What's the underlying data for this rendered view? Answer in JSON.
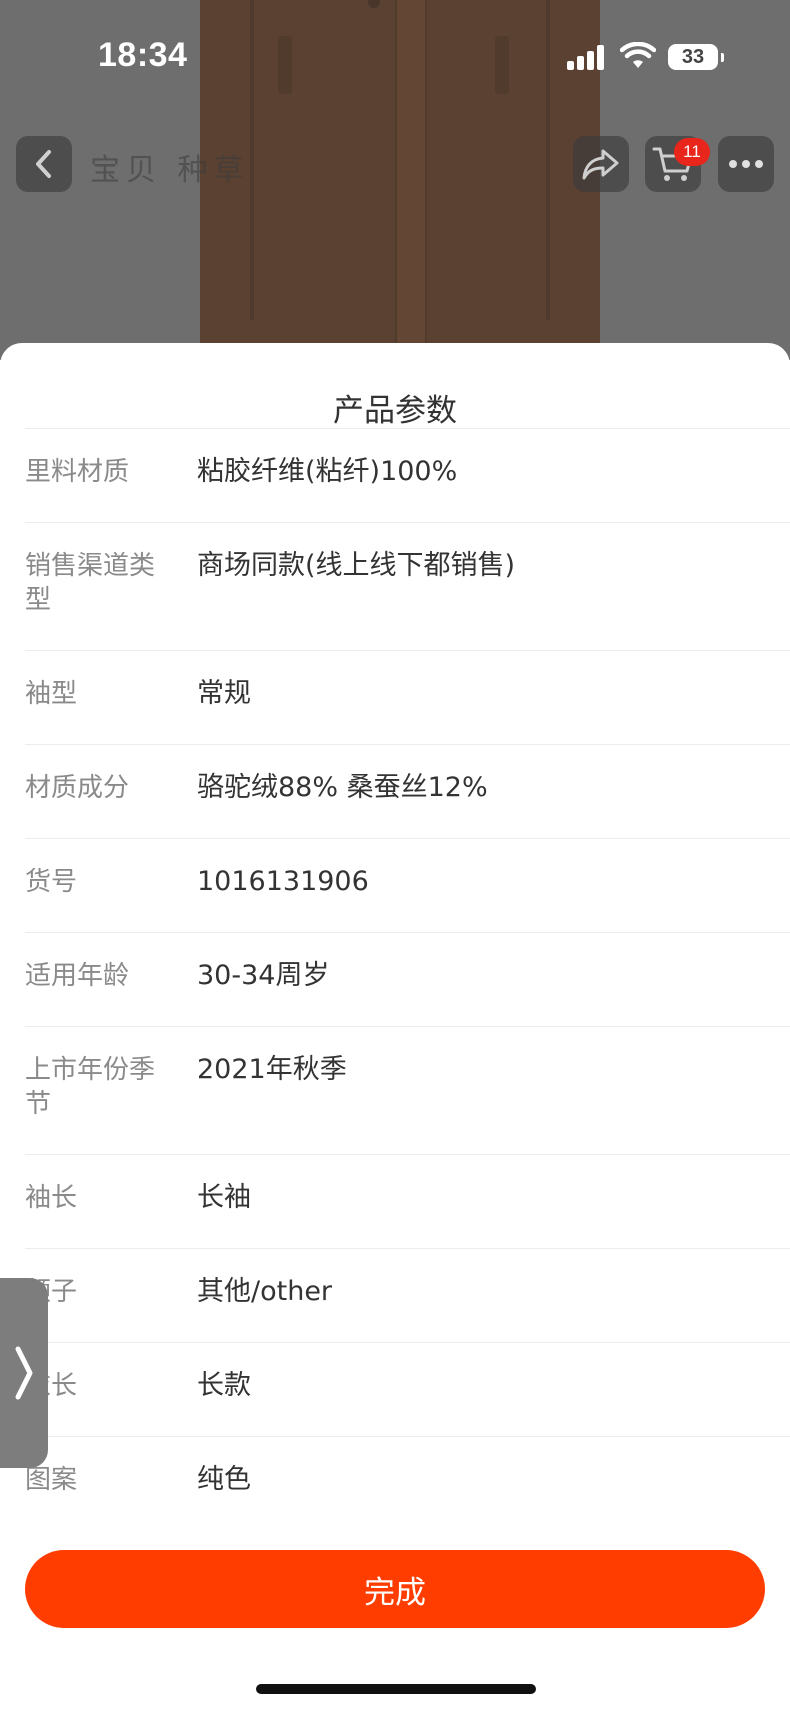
{
  "status_bar": {
    "time": "18:34",
    "battery": "33"
  },
  "nav": {
    "faded_title": "宝贝 种草",
    "cart_badge": "11"
  },
  "sheet": {
    "title": "产品参数",
    "params": [
      {
        "label": "里料材质",
        "value": "粘胶纤维(粘纤)100%"
      },
      {
        "label": "销售渠道类型",
        "value": "商场同款(线上线下都销售)"
      },
      {
        "label": "袖型",
        "value": "常规"
      },
      {
        "label": "材质成分",
        "value": "骆驼绒88% 桑蚕丝12%"
      },
      {
        "label": "货号",
        "value": "1016131906"
      },
      {
        "label": "适用年龄",
        "value": "30-34周岁"
      },
      {
        "label": "上市年份季节",
        "value": "2021年秋季"
      },
      {
        "label": "袖长",
        "value": "长袖"
      },
      {
        "label": "领子",
        "value": "其他/other"
      },
      {
        "label": "衣长",
        "value": "长款"
      },
      {
        "label": "图案",
        "value": "纯色"
      }
    ],
    "done_label": "完成"
  },
  "colors": {
    "accent": "#ff3d00",
    "badge": "#e8261b",
    "label_text": "#8a8a8a",
    "value_text": "#333333"
  },
  "icons": [
    "back-icon",
    "share-icon",
    "cart-icon",
    "more-icon",
    "chevron-right-icon",
    "signal-icon",
    "wifi-icon",
    "battery-icon"
  ]
}
